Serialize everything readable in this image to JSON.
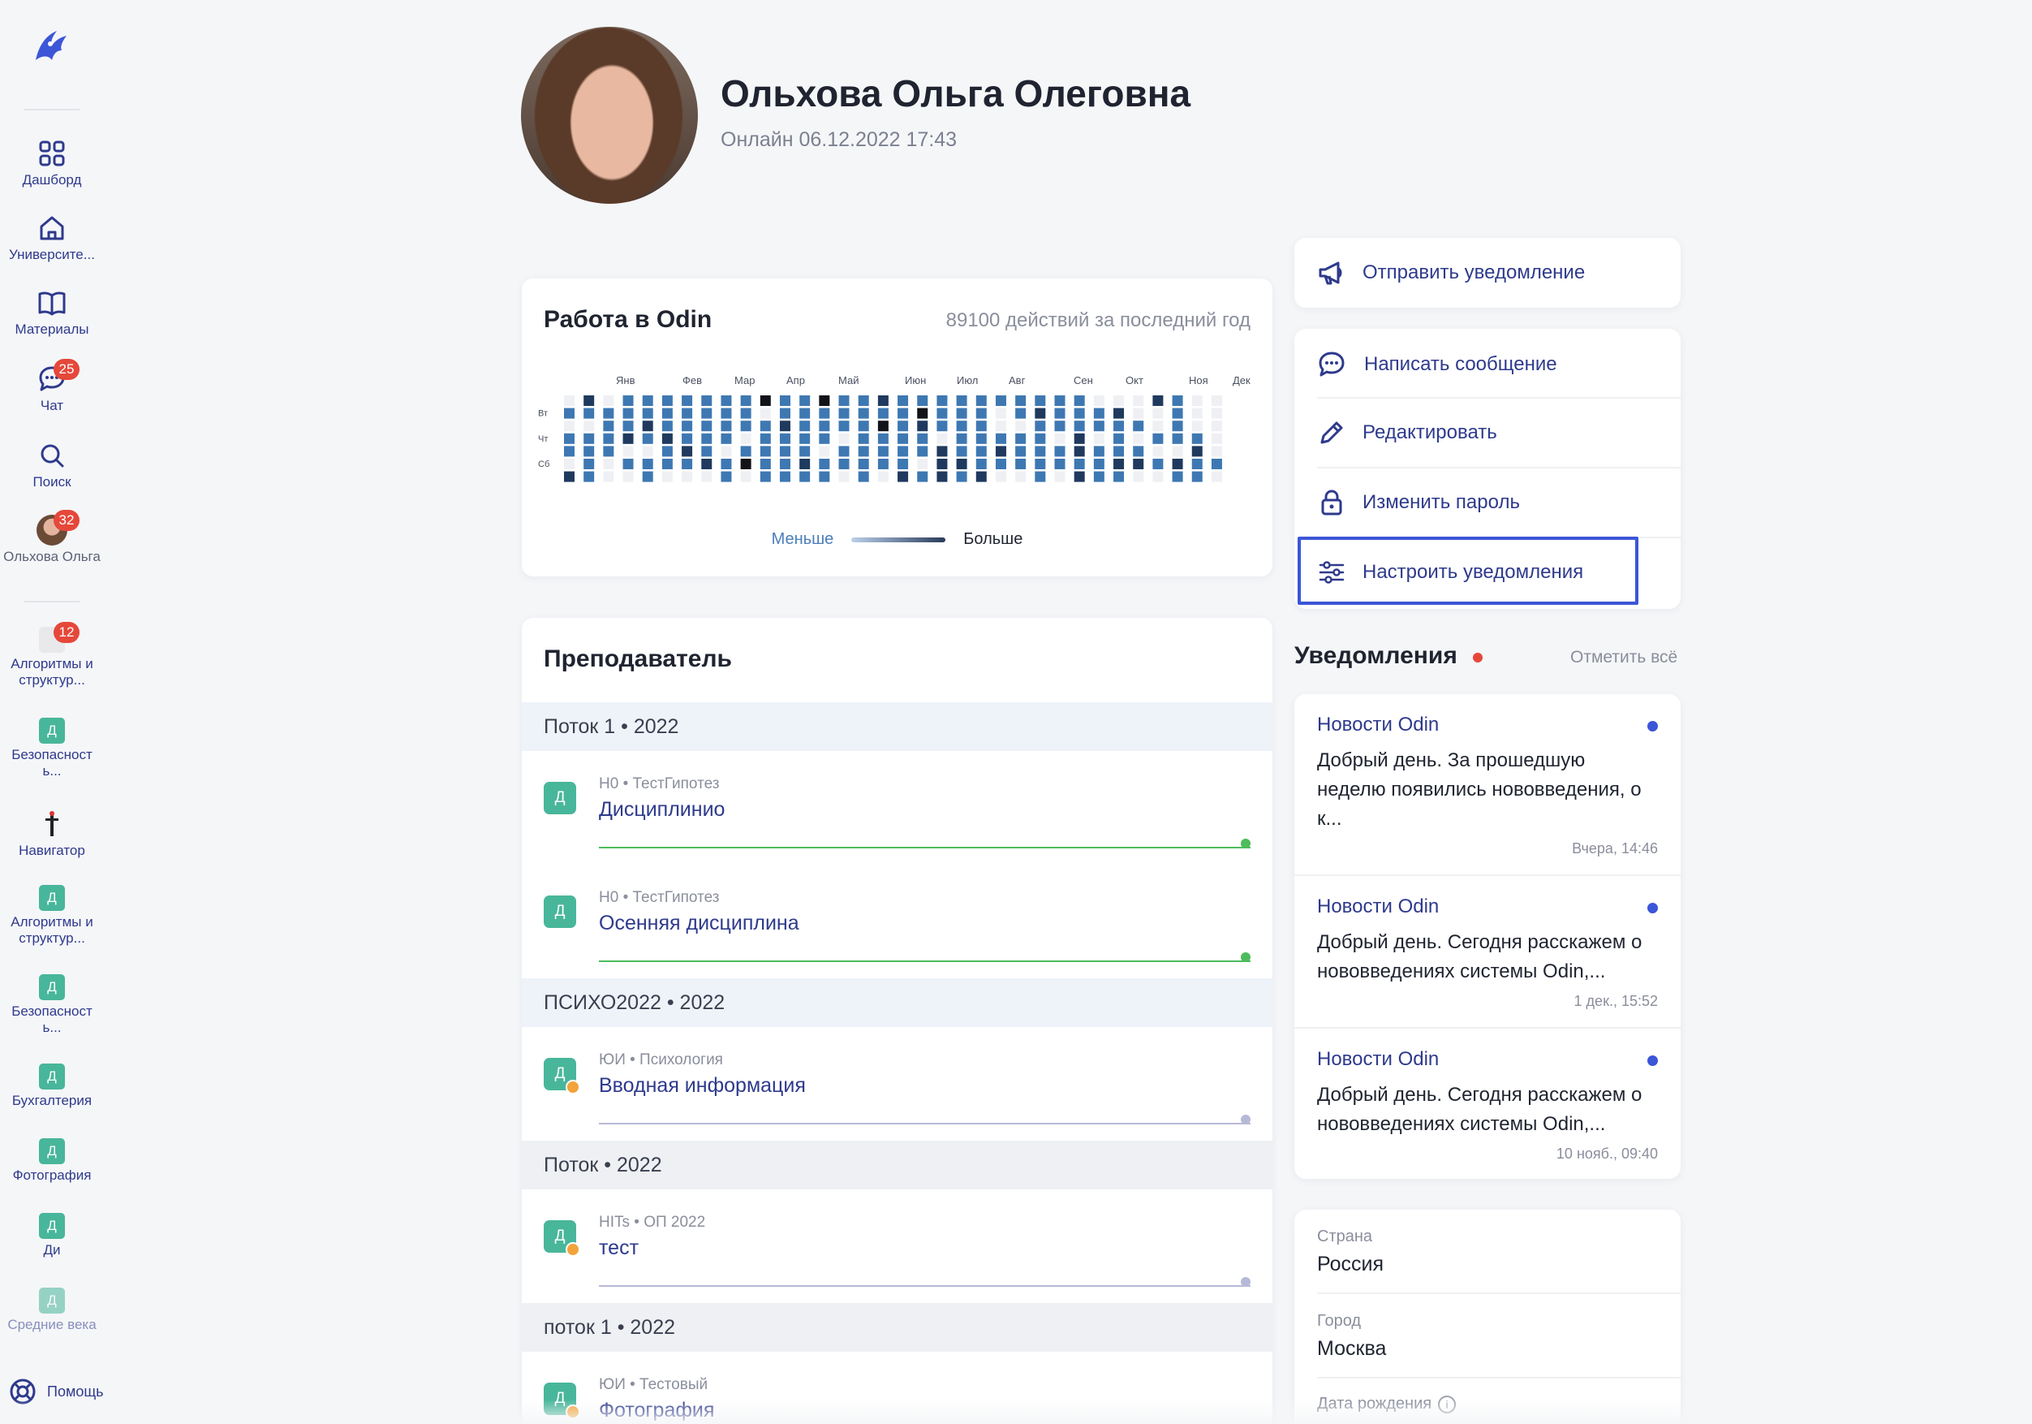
{
  "sidebar": {
    "nav": [
      {
        "label": "Дашборд",
        "icon": "grid-icon"
      },
      {
        "label": "Университе...",
        "icon": "home-icon"
      },
      {
        "label": "Материалы",
        "icon": "book-icon"
      },
      {
        "label": "Чат",
        "icon": "chat-icon",
        "badge": "25"
      },
      {
        "label": "Поиск",
        "icon": "search-icon"
      },
      {
        "label": "Ольхова Ольга",
        "icon": "avatar",
        "badge": "32"
      }
    ],
    "courses": [
      {
        "label": "Алгоритмы и структур...",
        "badge": "12",
        "icon": "course-image"
      },
      {
        "label": "Безопасност ь...",
        "letter": "Д"
      },
      {
        "label": "Навигатор",
        "icon": "navigator-image"
      },
      {
        "label": "Алгоритмы и структур...",
        "letter": "Д"
      },
      {
        "label": "Безопасност ь...",
        "letter": "Д"
      },
      {
        "label": "Бухгалтерия",
        "letter": "Д"
      },
      {
        "label": "Фотография",
        "letter": "Д"
      },
      {
        "label": "Ди",
        "letter": "Д"
      },
      {
        "label": "Средние века",
        "letter": "Д"
      }
    ],
    "help_label": "Помощь"
  },
  "profile": {
    "name": "Ольхова Ольга Олеговна",
    "online": "Онлайн 06.12.2022 17:43"
  },
  "activity": {
    "title": "Работа в Odin",
    "stat": "89100 действий за последний год",
    "months": [
      "Янв",
      "Фев",
      "Мар",
      "Апр",
      "Май",
      "Июн",
      "Июл",
      "Авг",
      "Сен",
      "Окт",
      "Ноя",
      "Дек"
    ],
    "weekdays": [
      "Вт",
      "Чт",
      "Сб"
    ],
    "legend_less": "Меньше",
    "legend_more": "Больше",
    "colors": {
      "empty": "#eef0f3",
      "mid": "#3e78b2",
      "high": "#1f3a5e",
      "max": "#111318"
    }
  },
  "teacher": {
    "title": "Преподаватель",
    "groups": [
      {
        "header": "Поток 1 • 2022",
        "courses": [
          {
            "letter": "Д",
            "meta": "Н0 • ТестГипотез",
            "name": "Дисциплинио",
            "status": "active"
          },
          {
            "letter": "Д",
            "meta": "Н0 • ТестГипотез",
            "name": "Осенняя дисциплина",
            "status": "active"
          }
        ]
      },
      {
        "header": "ПСИХО2022 • 2022",
        "courses": [
          {
            "letter": "Д",
            "meta": "ЮИ • Психология",
            "name": "Вводная информация",
            "status": "pending"
          }
        ]
      },
      {
        "header": "Поток • 2022",
        "courses": [
          {
            "letter": "Д",
            "meta": "HITs • ОП 2022",
            "name": "тест",
            "status": "pending"
          }
        ]
      },
      {
        "header": "поток 1 • 2022",
        "courses": [
          {
            "letter": "Д",
            "meta": "ЮИ • Тестовый",
            "name": "Фотография",
            "status": "pending"
          }
        ]
      }
    ]
  },
  "actions": {
    "send_notification": "Отправить уведомление",
    "write_message": "Написать сообщение",
    "edit": "Редактировать",
    "change_password": "Изменить пароль",
    "configure_notifications": "Настроить уведомления"
  },
  "notifications": {
    "title": "Уведомления",
    "mark_all": "Отметить всё",
    "items": [
      {
        "source": "Новости Odin",
        "text": "Добрый день. За прошедшую неделю появились нововведения, о к...",
        "time": "Вчера, 14:46"
      },
      {
        "source": "Новости Odin",
        "text": "Добрый день. Сегодня расскажем о нововведениях системы Odin,...",
        "time": "1 дек., 15:52"
      },
      {
        "source": "Новости Odin",
        "text": "Добрый день. Сегодня расскажем о нововведениях системы Odin,...",
        "time": "10 нояб., 09:40"
      }
    ]
  },
  "info": {
    "country_label": "Страна",
    "country": "Россия",
    "city_label": "Город",
    "city": "Москва",
    "birthday_label": "Дата рождения"
  },
  "colors": {
    "accent": "#2e3a8c",
    "highlight": "#3c56d8",
    "badge": "#e5483a",
    "course": "#48b69a",
    "progress": "#4cbc5c"
  }
}
